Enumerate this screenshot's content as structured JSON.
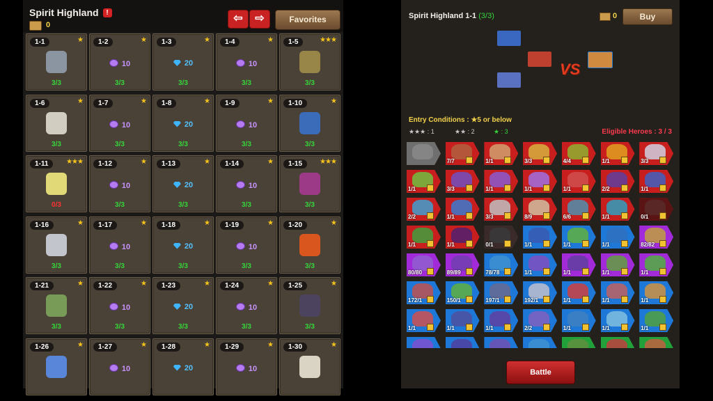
{
  "left": {
    "title": "Spirit Highland",
    "ticket_count": "0",
    "prev_arrow": "⇦",
    "next_arrow": "⇨",
    "favorites_label": "Favorites",
    "stages": [
      {
        "name": "1-1",
        "stars": "★",
        "reward": "",
        "reward_type": "boss",
        "progress": "3/3",
        "boss_color": "#8e9aa8"
      },
      {
        "name": "1-2",
        "stars": "★",
        "reward": "10",
        "reward_type": "purple",
        "progress": "3/3"
      },
      {
        "name": "1-3",
        "stars": "★",
        "reward": "20",
        "reward_type": "blue",
        "progress": "3/3"
      },
      {
        "name": "1-4",
        "stars": "★",
        "reward": "10",
        "reward_type": "purple",
        "progress": "3/3"
      },
      {
        "name": "1-5",
        "stars": "★★★",
        "reward": "",
        "reward_type": "boss",
        "progress": "3/3",
        "boss_color": "#9c8a4a"
      },
      {
        "name": "1-6",
        "stars": "★",
        "reward": "",
        "reward_type": "boss",
        "progress": "3/3",
        "boss_color": "#d8d6c8"
      },
      {
        "name": "1-7",
        "stars": "★",
        "reward": "10",
        "reward_type": "purple",
        "progress": "3/3"
      },
      {
        "name": "1-8",
        "stars": "★",
        "reward": "20",
        "reward_type": "blue",
        "progress": "3/3"
      },
      {
        "name": "1-9",
        "stars": "★",
        "reward": "10",
        "reward_type": "purple",
        "progress": "3/3"
      },
      {
        "name": "1-10",
        "stars": "★",
        "reward": "",
        "reward_type": "boss",
        "progress": "3/3",
        "boss_color": "#3a6fc0"
      },
      {
        "name": "1-11",
        "stars": "★★★",
        "reward": "",
        "reward_type": "boss",
        "progress": "0/3",
        "bad": true,
        "boss_color": "#e9e07a"
      },
      {
        "name": "1-12",
        "stars": "★",
        "reward": "10",
        "reward_type": "purple",
        "progress": "3/3"
      },
      {
        "name": "1-13",
        "stars": "★",
        "reward": "20",
        "reward_type": "blue",
        "progress": "3/3"
      },
      {
        "name": "1-14",
        "stars": "★",
        "reward": "10",
        "reward_type": "purple",
        "progress": "3/3"
      },
      {
        "name": "1-15",
        "stars": "★★★",
        "reward": "",
        "reward_type": "boss",
        "progress": "3/3",
        "boss_color": "#a03a8c"
      },
      {
        "name": "1-16",
        "stars": "★",
        "reward": "",
        "reward_type": "boss",
        "progress": "3/3",
        "boss_color": "#c8ccd4"
      },
      {
        "name": "1-17",
        "stars": "★",
        "reward": "10",
        "reward_type": "purple",
        "progress": "3/3"
      },
      {
        "name": "1-18",
        "stars": "★",
        "reward": "20",
        "reward_type": "blue",
        "progress": "3/3"
      },
      {
        "name": "1-19",
        "stars": "★",
        "reward": "10",
        "reward_type": "purple",
        "progress": "3/3"
      },
      {
        "name": "1-20",
        "stars": "★",
        "reward": "",
        "reward_type": "boss",
        "progress": "3/3",
        "boss_color": "#e2571e"
      },
      {
        "name": "1-21",
        "stars": "★",
        "reward": "",
        "reward_type": "boss",
        "progress": "3/3",
        "boss_color": "#7aa15a"
      },
      {
        "name": "1-22",
        "stars": "★",
        "reward": "10",
        "reward_type": "purple",
        "progress": "3/3"
      },
      {
        "name": "1-23",
        "stars": "★",
        "reward": "20",
        "reward_type": "blue",
        "progress": "3/3"
      },
      {
        "name": "1-24",
        "stars": "★",
        "reward": "10",
        "reward_type": "purple",
        "progress": "3/3"
      },
      {
        "name": "1-25",
        "stars": "★",
        "reward": "",
        "reward_type": "boss",
        "progress": "3/3",
        "boss_color": "#4c4560"
      },
      {
        "name": "1-26",
        "stars": "★",
        "reward": "",
        "reward_type": "boss",
        "progress": "",
        "boss_color": "#5a8ae0"
      },
      {
        "name": "1-27",
        "stars": "★",
        "reward": "10",
        "reward_type": "purple",
        "progress": ""
      },
      {
        "name": "1-28",
        "stars": "★",
        "reward": "20",
        "reward_type": "blue",
        "progress": ""
      },
      {
        "name": "1-29",
        "stars": "★",
        "reward": "10",
        "reward_type": "purple",
        "progress": ""
      },
      {
        "name": "1-30",
        "stars": "★",
        "reward": "",
        "reward_type": "boss",
        "progress": "",
        "boss_color": "#e0dccb"
      }
    ]
  },
  "right": {
    "title": "Spirit Highland 1-1",
    "title_progress": "(3/3)",
    "ticket_count": "0",
    "buy_label": "Buy",
    "vs_label": "VS",
    "entry_conditions": "Entry Conditions : ★5 or below",
    "categories": [
      {
        "label": "★★★ : 1",
        "color": "#c8c8c8"
      },
      {
        "label": "★★ : 2",
        "color": "#c8c8c8"
      },
      {
        "label": "★ : 3",
        "color": "#35d53a"
      }
    ],
    "eligible": "Eligible Heroes : 3 / 3",
    "battle_label": "Battle",
    "heroes": [
      {
        "lvl": "",
        "c": "#6f6f6f",
        "f": "#8a8a8a"
      },
      {
        "lvl": "7/7",
        "c": "#c81e1e",
        "f": "#b06040"
      },
      {
        "lvl": "1/1",
        "c": "#c81e1e",
        "f": "#d0a070"
      },
      {
        "lvl": "3/3",
        "c": "#c81e1e",
        "f": "#d6b040"
      },
      {
        "lvl": "4/4",
        "c": "#c81e1e",
        "f": "#90b030"
      },
      {
        "lvl": "1/1",
        "c": "#c81e1e",
        "f": "#e0a020"
      },
      {
        "lvl": "3/3",
        "c": "#c81e1e",
        "f": "#d0d0e0"
      },
      {
        "lvl": "1/1",
        "c": "#c81e1e",
        "f": "#70c040"
      },
      {
        "lvl": "3/3",
        "c": "#c81e1e",
        "f": "#7050c0"
      },
      {
        "lvl": "1/1",
        "c": "#c81e1e",
        "f": "#8a5ad0"
      },
      {
        "lvl": "1/1",
        "c": "#c81e1e",
        "f": "#a070e0"
      },
      {
        "lvl": "1/1",
        "c": "#c81e1e",
        "f": "#d05050"
      },
      {
        "lvl": "2/2",
        "c": "#c81e1e",
        "f": "#6040a0"
      },
      {
        "lvl": "1/1",
        "c": "#c81e1e",
        "f": "#4060c0"
      },
      {
        "lvl": "2/2",
        "c": "#c81e1e",
        "f": "#40a0d0"
      },
      {
        "lvl": "1/1",
        "c": "#c81e1e",
        "f": "#3a7ad0"
      },
      {
        "lvl": "3/3",
        "c": "#c81e1e",
        "f": "#c0c0c0"
      },
      {
        "lvl": "8/9",
        "c": "#c81e1e",
        "f": "#d0c0a0"
      },
      {
        "lvl": "6/6",
        "c": "#c81e1e",
        "f": "#5090b0"
      },
      {
        "lvl": "1/1",
        "c": "#c81e1e",
        "f": "#30a0c0"
      },
      {
        "lvl": "0/1",
        "c": "#5a1414",
        "f": "#5a2a2a"
      },
      {
        "lvl": "1/1",
        "c": "#c81e1e",
        "f": "#40a040"
      },
      {
        "lvl": "1/1",
        "c": "#c81e1e",
        "f": "#502070"
      },
      {
        "lvl": "0/1",
        "c": "#3a2a2a",
        "f": "#3a3a3a"
      },
      {
        "lvl": "1/1",
        "c": "#1e78d8",
        "f": "#3a5ab0"
      },
      {
        "lvl": "1/1",
        "c": "#1e78d8",
        "f": "#60b040"
      },
      {
        "lvl": "1/1",
        "c": "#1e78d8",
        "f": "#3070c0"
      },
      {
        "lvl": "82/82",
        "c": "#a22ad8",
        "f": "#c0a040"
      },
      {
        "lvl": "80/80",
        "c": "#a22ad8",
        "f": "#9060d0"
      },
      {
        "lvl": "89/89",
        "c": "#a22ad8",
        "f": "#7040b0"
      },
      {
        "lvl": "78/78",
        "c": "#1e78d8",
        "f": "#4090d0"
      },
      {
        "lvl": "1/1",
        "c": "#1e78d8",
        "f": "#8050c0"
      },
      {
        "lvl": "1/1",
        "c": "#a22ad8",
        "f": "#6040a0"
      },
      {
        "lvl": "1/1",
        "c": "#a22ad8",
        "f": "#60a040"
      },
      {
        "lvl": "1/1",
        "c": "#a22ad8",
        "f": "#50b040"
      },
      {
        "lvl": "172/1",
        "c": "#1e78d8",
        "f": "#c05050"
      },
      {
        "lvl": "150/1",
        "c": "#1e78d8",
        "f": "#60b040"
      },
      {
        "lvl": "197/1",
        "c": "#1e78d8",
        "f": "#6a6a90"
      },
      {
        "lvl": "192/1",
        "c": "#1e78d8",
        "f": "#c0c0d0"
      },
      {
        "lvl": "1/1",
        "c": "#1e78d8",
        "f": "#d04040"
      },
      {
        "lvl": "1/1",
        "c": "#1e78d8",
        "f": "#c06060"
      },
      {
        "lvl": "1/1",
        "c": "#1e78d8",
        "f": "#d09040"
      },
      {
        "lvl": "1/1",
        "c": "#1e78d8",
        "f": "#d05050"
      },
      {
        "lvl": "1/1",
        "c": "#1e78d8",
        "f": "#5050a0"
      },
      {
        "lvl": "1/1",
        "c": "#1e78d8",
        "f": "#6040a0"
      },
      {
        "lvl": "2/2",
        "c": "#1e78d8",
        "f": "#8060c0"
      },
      {
        "lvl": "1/1",
        "c": "#1e78d8",
        "f": "#4080c0"
      },
      {
        "lvl": "1/1",
        "c": "#1e78d8",
        "f": "#80c0e0"
      },
      {
        "lvl": "1/1",
        "c": "#1e78d8",
        "f": "#50a040"
      },
      {
        "lvl": "",
        "c": "#1e78d8",
        "f": "#8050d0"
      },
      {
        "lvl": "",
        "c": "#1e78d8",
        "f": "#5040a0"
      },
      {
        "lvl": "",
        "c": "#1e78d8",
        "f": "#7050b0"
      },
      {
        "lvl": "",
        "c": "#1e78d8",
        "f": "#4090d0"
      },
      {
        "lvl": "",
        "c": "#22a03a",
        "f": "#609040"
      },
      {
        "lvl": "",
        "c": "#22a03a",
        "f": "#c04040"
      },
      {
        "lvl": "",
        "c": "#22a03a",
        "f": "#c06040"
      }
    ]
  }
}
